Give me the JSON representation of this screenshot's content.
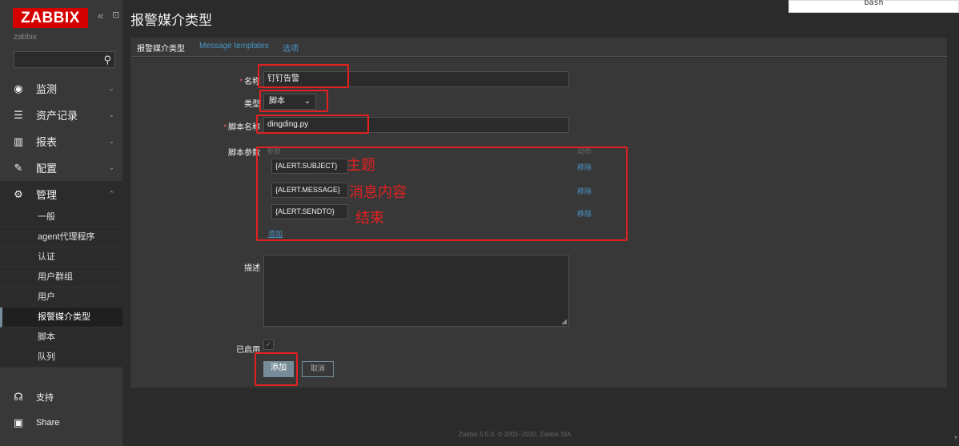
{
  "sidebar": {
    "brand": "ZABBIX",
    "collapse_icon": "«",
    "kiosk_icon": "⊡",
    "instance": "zabbix",
    "menu": [
      {
        "label": "监测",
        "icon": "eye-icon"
      },
      {
        "label": "资产记录",
        "icon": "list-icon"
      },
      {
        "label": "报表",
        "icon": "chart-icon"
      },
      {
        "label": "配置",
        "icon": "wrench-icon"
      },
      {
        "label": "管理",
        "icon": "gear-icon"
      }
    ],
    "admin_sub": [
      "一般",
      "agent代理程序",
      "认证",
      "用户群组",
      "用户",
      "报警媒介类型",
      "脚本",
      "队列"
    ],
    "bottom": [
      {
        "label": "支持",
        "icon": "headset-icon"
      },
      {
        "label": "Share",
        "icon": "share-icon"
      }
    ]
  },
  "page": {
    "title": "报警媒介类型",
    "tabs": [
      "报警媒介类型",
      "Message templates",
      "选项"
    ]
  },
  "form": {
    "name_label": "名称",
    "name_value": "钉钉告警",
    "type_label": "类型",
    "type_value": "脚本",
    "script_name_label": "脚本名称",
    "script_name_value": "dingding.py",
    "params_label": "脚本参数",
    "params_col_header": "参数",
    "action_col_header": "动作",
    "params": [
      "{ALERT.SUBJECT}",
      "{ALERT.MESSAGE}",
      "{ALERT.SENDTO}"
    ],
    "remove_label": "移除",
    "add_link": "添加",
    "description_label": "描述",
    "enabled_label": "已启用",
    "add_button": "添加",
    "cancel_button": "取消"
  },
  "annotations": [
    "主题",
    "消息内容",
    "结束"
  ],
  "footer": "Zabbix 5.0.0. © 2001–2020, Zabbix SIA",
  "popup": {
    "text": "bash"
  },
  "colors": {
    "brand": "#d40000",
    "accent": "#768d99",
    "link": "#4796c4",
    "annotation": "#e32020"
  }
}
